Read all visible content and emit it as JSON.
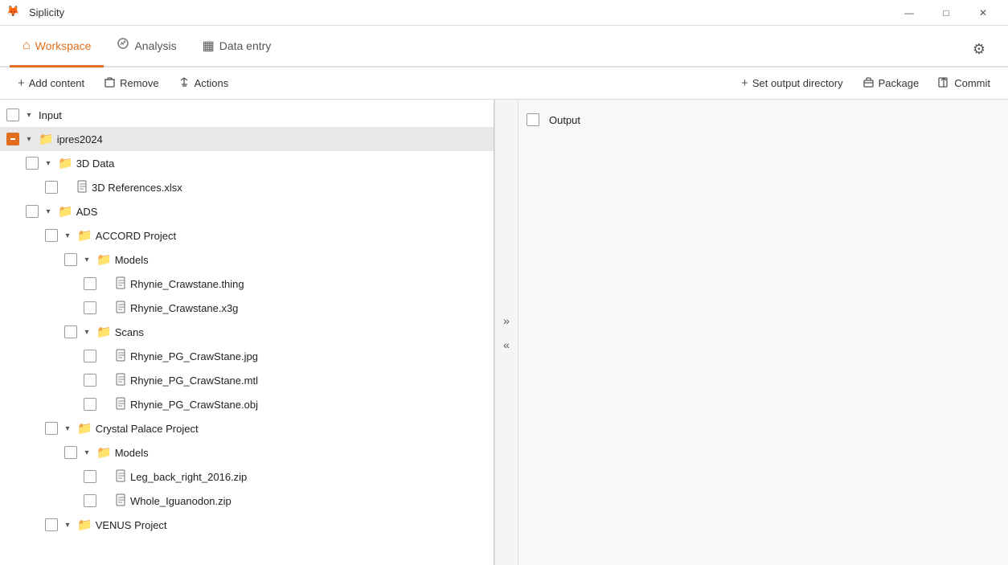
{
  "app": {
    "name": "Siplicity",
    "icon": "🦊"
  },
  "titlebar": {
    "minimize": "—",
    "maximize": "□",
    "close": "✕"
  },
  "nav": {
    "tabs": [
      {
        "id": "workspace",
        "label": "Workspace",
        "icon": "⌂",
        "active": true
      },
      {
        "id": "analysis",
        "label": "Analysis",
        "icon": "📊",
        "active": false
      },
      {
        "id": "data-entry",
        "label": "Data entry",
        "icon": "▦",
        "active": false
      }
    ],
    "settings_icon": "⚙"
  },
  "toolbar": {
    "left": [
      {
        "id": "add-content",
        "icon": "+",
        "label": "Add content"
      },
      {
        "id": "remove",
        "icon": "🗑",
        "label": "Remove"
      },
      {
        "id": "actions",
        "icon": "⇄",
        "label": "Actions"
      }
    ],
    "right": [
      {
        "id": "set-output-dir",
        "icon": "+",
        "label": "Set output directory"
      },
      {
        "id": "package",
        "icon": "📦",
        "label": "Package"
      },
      {
        "id": "commit",
        "icon": "↗",
        "label": "Commit"
      }
    ]
  },
  "left_panel": {
    "section_label": "Input",
    "tree": [
      {
        "id": "ipres2024",
        "level": 1,
        "type": "folder",
        "label": "ipres2024",
        "checked": "partial",
        "expanded": true
      },
      {
        "id": "3d-data",
        "level": 2,
        "type": "folder",
        "label": "3D Data",
        "checked": "unchecked",
        "expanded": true
      },
      {
        "id": "3d-references",
        "level": 3,
        "type": "file",
        "label": "3D References.xlsx",
        "checked": "unchecked"
      },
      {
        "id": "ads",
        "level": 2,
        "type": "folder",
        "label": "ADS",
        "checked": "unchecked",
        "expanded": true
      },
      {
        "id": "accord-project",
        "level": 3,
        "type": "folder",
        "label": "ACCORD Project",
        "checked": "unchecked",
        "expanded": true
      },
      {
        "id": "models-accord",
        "level": 4,
        "type": "folder",
        "label": "Models",
        "checked": "unchecked",
        "expanded": true
      },
      {
        "id": "rhynie-thing",
        "level": 5,
        "type": "file",
        "label": "Rhynie_Crawstane.thing",
        "checked": "unchecked"
      },
      {
        "id": "rhynie-x3g",
        "level": 5,
        "type": "file",
        "label": "Rhynie_Crawstane.x3g",
        "checked": "unchecked"
      },
      {
        "id": "scans",
        "level": 4,
        "type": "folder",
        "label": "Scans",
        "checked": "unchecked",
        "expanded": true
      },
      {
        "id": "rhynie-jpg",
        "level": 5,
        "type": "file",
        "label": "Rhynie_PG_CrawStane.jpg",
        "checked": "unchecked"
      },
      {
        "id": "rhynie-mtl",
        "level": 5,
        "type": "file",
        "label": "Rhynie_PG_CrawStane.mtl",
        "checked": "unchecked"
      },
      {
        "id": "rhynie-obj",
        "level": 5,
        "type": "file",
        "label": "Rhynie_PG_CrawStane.obj",
        "checked": "unchecked"
      },
      {
        "id": "crystal-palace",
        "level": 3,
        "type": "folder",
        "label": "Crystal Palace Project",
        "checked": "unchecked",
        "expanded": true
      },
      {
        "id": "models-crystal",
        "level": 4,
        "type": "folder",
        "label": "Models",
        "checked": "unchecked",
        "expanded": true
      },
      {
        "id": "leg-back",
        "level": 5,
        "type": "file",
        "label": "Leg_back_right_2016.zip",
        "checked": "unchecked"
      },
      {
        "id": "whole-iguanodon",
        "level": 5,
        "type": "file",
        "label": "Whole_Iguanodon.zip",
        "checked": "unchecked"
      },
      {
        "id": "venus-project",
        "level": 3,
        "type": "folder",
        "label": "VENUS Project",
        "checked": "unchecked",
        "expanded": false
      }
    ]
  },
  "right_panel": {
    "section_label": "Output"
  },
  "divider": {
    "forward": "»",
    "back": "«"
  }
}
